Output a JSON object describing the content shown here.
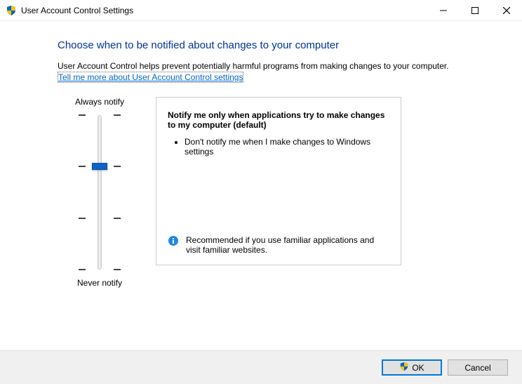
{
  "window": {
    "title": "User Account Control Settings"
  },
  "page": {
    "heading": "Choose when to be notified about changes to your computer",
    "description": "User Account Control helps prevent potentially harmful programs from making changes to your computer.",
    "link_text": "Tell me more about User Account Control settings"
  },
  "slider": {
    "top_label": "Always notify",
    "bottom_label": "Never notify",
    "levels": 4,
    "current_index_from_top": 1
  },
  "info_panel": {
    "title": "Notify me only when applications try to make changes to my computer (default)",
    "bullets": [
      "Don't notify me when I make changes to Windows settings"
    ],
    "recommendation": "Recommended if you use familiar applications and visit familiar websites."
  },
  "footer": {
    "ok_label": "OK",
    "cancel_label": "Cancel"
  }
}
